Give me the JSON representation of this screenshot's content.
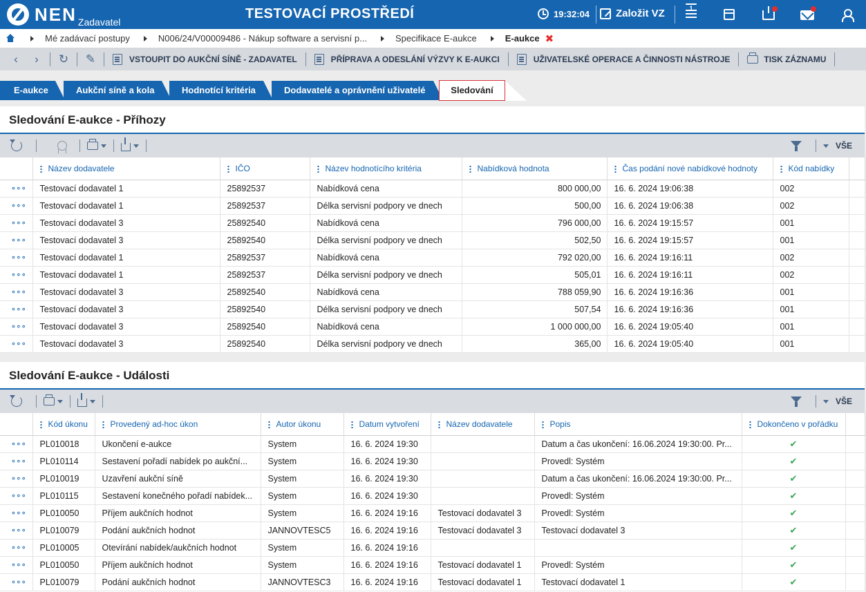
{
  "header": {
    "logo_text": "NEN",
    "logo_sub": "Zadavatel",
    "env_title": "TESTOVACÍ PROSTŘEDÍ",
    "time": "19:32:04",
    "create_label": "Založit VZ",
    "menu_badge": "1",
    "icons": [
      "clock-icon",
      "edit-icon",
      "menu-icon",
      "calculator-icon",
      "tray-icon",
      "mail-icon",
      "user-icon"
    ],
    "accent": "#1565b0",
    "alert_color": "#e52d2d"
  },
  "breadcrumb": {
    "items": [
      "Mé zadávací postupy",
      "N006/24/V00009486 - Nákup software a servisní p...",
      "Specifikace E-aukce"
    ],
    "current": "E-aukce",
    "close": "✖"
  },
  "toolbar": {
    "enter_hall": "VSTOUPIT DO AUKČNÍ SÍNĚ - ZADAVATEL",
    "prepare_call": "PŘÍPRAVA A ODESLÁNÍ VÝZVY K E-AUKCI",
    "user_ops": "UŽIVATELSKÉ OPERACE A ČINNOSTI NÁSTROJE",
    "print_record": "TISK ZÁZNAMU"
  },
  "tabs": {
    "items": [
      "E-aukce",
      "Aukční síně a kola",
      "Hodnotící kritéria",
      "Dodavatelé a oprávnění uživatelé"
    ],
    "active": "Sledování"
  },
  "bids": {
    "title": "Sledování E-aukce - Příhozy",
    "filter_label": "VŠE",
    "columns": [
      "Název dodavatele",
      "IČO",
      "Název hodnotícího kritéria",
      "Nabídková hodnota",
      "Čas podání nové nabídkové hodnoty",
      "Kód nabídky"
    ],
    "rows": [
      [
        "Testovací dodavatel 1",
        "25892537",
        "Nabídková cena",
        "800 000,00",
        "16. 6. 2024 19:06:38",
        "002"
      ],
      [
        "Testovací dodavatel 1",
        "25892537",
        "Délka servisní podpory ve dnech",
        "500,00",
        "16. 6. 2024 19:06:38",
        "002"
      ],
      [
        "Testovací dodavatel 3",
        "25892540",
        "Nabídková cena",
        "796 000,00",
        "16. 6. 2024 19:15:57",
        "001"
      ],
      [
        "Testovací dodavatel 3",
        "25892540",
        "Délka servisní podpory ve dnech",
        "502,50",
        "16. 6. 2024 19:15:57",
        "001"
      ],
      [
        "Testovací dodavatel 1",
        "25892537",
        "Nabídková cena",
        "792 020,00",
        "16. 6. 2024 19:16:11",
        "002"
      ],
      [
        "Testovací dodavatel 1",
        "25892537",
        "Délka servisní podpory ve dnech",
        "505,01",
        "16. 6. 2024 19:16:11",
        "002"
      ],
      [
        "Testovací dodavatel 3",
        "25892540",
        "Nabídková cena",
        "788 059,90",
        "16. 6. 2024 19:16:36",
        "001"
      ],
      [
        "Testovací dodavatel 3",
        "25892540",
        "Délka servisní podpory ve dnech",
        "507,54",
        "16. 6. 2024 19:16:36",
        "001"
      ],
      [
        "Testovací dodavatel 3",
        "25892540",
        "Nabídková cena",
        "1 000 000,00",
        "16. 6. 2024 19:05:40",
        "001"
      ],
      [
        "Testovací dodavatel 3",
        "25892540",
        "Délka servisní podpory ve dnech",
        "365,00",
        "16. 6. 2024 19:05:40",
        "001"
      ]
    ]
  },
  "events": {
    "title": "Sledování E-aukce - Události",
    "filter_label": "VŠE",
    "check_mark": "✔",
    "columns": [
      "Kód úkonu",
      "Provedený ad-hoc úkon",
      "Autor úkonu",
      "Datum vytvoření",
      "Název dodavatele",
      "Popis",
      "Dokončeno v pořádku"
    ],
    "rows": [
      [
        "PL010018",
        "Ukončení e-aukce",
        "System",
        "16. 6. 2024 19:30",
        "",
        "Datum a čas ukončení: 16.06.2024 19:30:00. Pr...",
        true
      ],
      [
        "PL010114",
        "Sestavení pořadí nabídek po aukční...",
        "System",
        "16. 6. 2024 19:30",
        "",
        "Provedl: Systém",
        true
      ],
      [
        "PL010019",
        "Uzavření aukční síně",
        "System",
        "16. 6. 2024 19:30",
        "",
        "Datum a čas ukončení: 16.06.2024 19:30:00. Pr...",
        true
      ],
      [
        "PL010115",
        "Sestavení konečného pořadí nabídek...",
        "System",
        "16. 6. 2024 19:30",
        "",
        "Provedl: Systém",
        true
      ],
      [
        "PL010050",
        "Příjem aukčních hodnot",
        "System",
        "16. 6. 2024 19:16",
        "Testovací dodavatel 3",
        "Provedl: Systém",
        true
      ],
      [
        "PL010079",
        "Podání aukčních hodnot",
        "JANNOVTESC5",
        "16. 6. 2024 19:16",
        "Testovací dodavatel 3",
        "Testovací dodavatel 3",
        true
      ],
      [
        "PL010005",
        "Otevírání nabídek/aukčních hodnot",
        "System",
        "16. 6. 2024 19:16",
        "",
        "",
        true
      ],
      [
        "PL010050",
        "Příjem aukčních hodnot",
        "System",
        "16. 6. 2024 19:16",
        "Testovací dodavatel 1",
        "Provedl: Systém",
        true
      ],
      [
        "PL010079",
        "Podání aukčních hodnot",
        "JANNOVTESC3",
        "16. 6. 2024 19:16",
        "Testovací dodavatel 1",
        "Testovací dodavatel 1",
        true
      ]
    ]
  },
  "row_menu": "∘∘∘"
}
